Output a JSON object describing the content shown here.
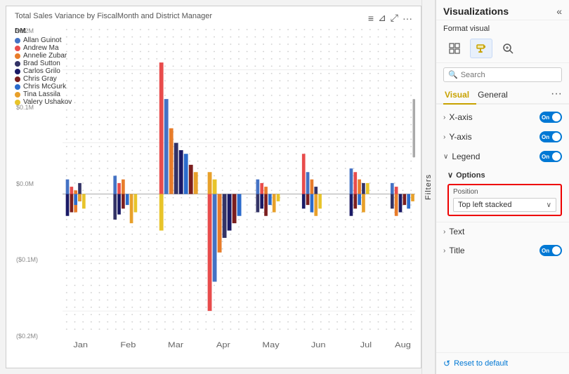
{
  "chart": {
    "title": "Total Sales Variance by FiscalMonth and District Manager",
    "handle_icon": "≡",
    "filter_icon": "⊲",
    "expand_icon": "⤢",
    "more_icon": "•••",
    "legend_header": "DM",
    "legend_items": [
      {
        "label": "Allan Guinot",
        "color": "#4472c4"
      },
      {
        "label": "Andrew Ma",
        "color": "#e84c4c"
      },
      {
        "label": "Annelie Zubar",
        "color": "#e87c2a"
      },
      {
        "label": "Brad Sutton",
        "color": "#333366"
      },
      {
        "label": "Carlos Grilo",
        "color": "#1a1a66"
      },
      {
        "label": "Chris Gray",
        "color": "#7b1e1e"
      },
      {
        "label": "Chris McGurk",
        "color": "#2b6bcc"
      },
      {
        "label": "Tina Lassila",
        "color": "#e8a02a"
      },
      {
        "label": "Valery Ushakov",
        "color": "#e8c42a"
      }
    ],
    "y_labels": [
      "$0.2M",
      "$0.1M",
      "$0.0M",
      "($0.1M)",
      "($0.2M)"
    ],
    "x_labels": [
      "Jan",
      "Feb",
      "Mar",
      "Apr",
      "May",
      "Jun",
      "Jul",
      "Aug"
    ]
  },
  "filters": {
    "label": "Filters"
  },
  "panel": {
    "title": "Visualizations",
    "collapse_icon": "«",
    "expand_icon": "»",
    "format_visual_label": "Format visual",
    "format_icons": [
      {
        "name": "table-icon",
        "symbol": "▦",
        "active": false
      },
      {
        "name": "paint-icon",
        "symbol": "🖌",
        "active": true
      },
      {
        "name": "analytics-icon",
        "symbol": "⚲",
        "active": false
      }
    ],
    "search": {
      "placeholder": "Search",
      "value": ""
    },
    "tabs": [
      {
        "label": "Visual",
        "active": true
      },
      {
        "label": "General",
        "active": false
      }
    ],
    "tab_more": "···",
    "sections": [
      {
        "label": "X-axis",
        "expanded": false,
        "has_toggle": true,
        "toggle_on": true
      },
      {
        "label": "Y-axis",
        "expanded": false,
        "has_toggle": true,
        "toggle_on": true
      },
      {
        "label": "Legend",
        "expanded": true,
        "has_toggle": true,
        "toggle_on": true
      }
    ],
    "legend_subsection": {
      "options_label": "Options",
      "position_label": "Position",
      "position_value": "Top left stacked",
      "position_chevron": "∨"
    },
    "text_section": {
      "label": "Text",
      "expanded": false,
      "has_toggle": false
    },
    "title_section": {
      "label": "Title",
      "expanded": false,
      "has_toggle": true,
      "toggle_on": true
    },
    "reset_label": "Reset to default"
  }
}
